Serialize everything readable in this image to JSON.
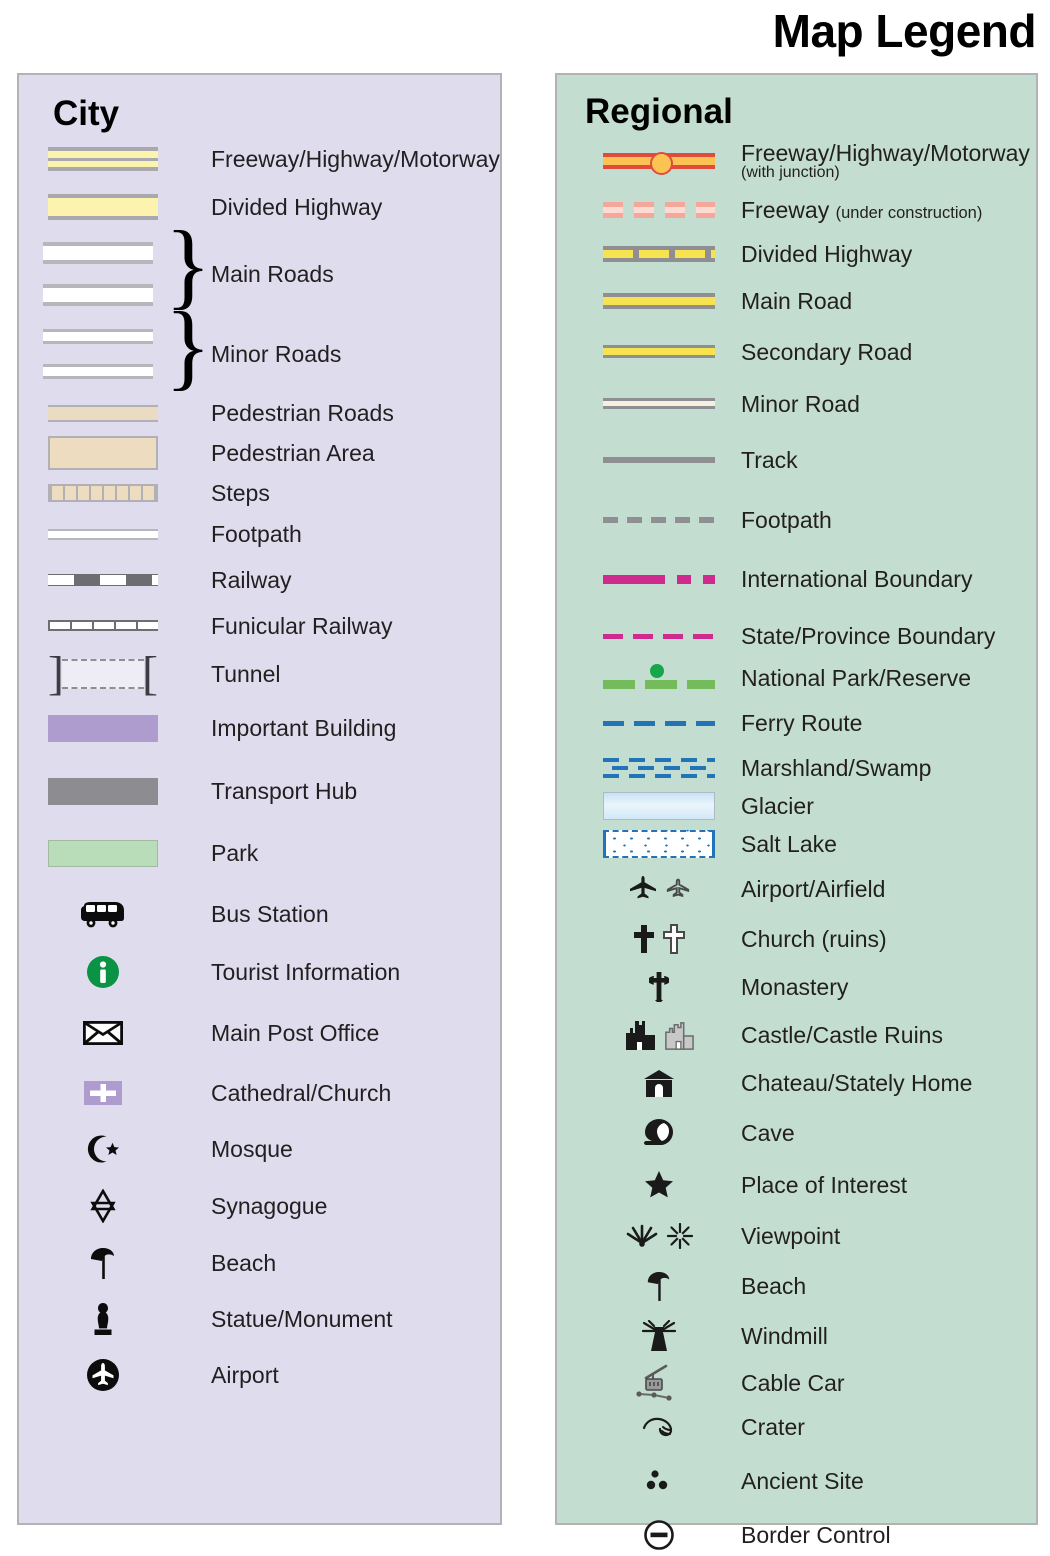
{
  "title": "Map Legend",
  "panels": {
    "city": {
      "heading": "City",
      "background_color": "#dedced",
      "items": [
        {
          "label": "Freeway/Highway/Motorway",
          "symbol": "freeway-band"
        },
        {
          "label": "Divided Highway",
          "symbol": "divided-highway-band"
        },
        {
          "label": "Main Roads",
          "symbol": "main-roads-brace-pair"
        },
        {
          "label": "Minor Roads",
          "symbol": "minor-roads-brace-pair"
        },
        {
          "label": "Pedestrian Roads",
          "symbol": "pedestrian-road-band"
        },
        {
          "label": "Pedestrian Area",
          "symbol": "pedestrian-area-swatch"
        },
        {
          "label": "Steps",
          "symbol": "steps-band"
        },
        {
          "label": "Footpath",
          "symbol": "footpath-line"
        },
        {
          "label": "Railway",
          "symbol": "railway-line"
        },
        {
          "label": "Funicular Railway",
          "symbol": "funicular-railway-line"
        },
        {
          "label": "Tunnel",
          "symbol": "tunnel-brackets"
        },
        {
          "label": "Important Building",
          "symbol": "important-building-swatch"
        },
        {
          "label": "Transport Hub",
          "symbol": "transport-hub-swatch"
        },
        {
          "label": "Park",
          "symbol": "park-swatch"
        },
        {
          "label": "Bus Station",
          "symbol": "bus-icon"
        },
        {
          "label": "Tourist Information",
          "symbol": "information-icon"
        },
        {
          "label": "Main Post Office",
          "symbol": "envelope-icon"
        },
        {
          "label": "Cathedral/Church",
          "symbol": "cross-on-purple-icon"
        },
        {
          "label": "Mosque",
          "symbol": "crescent-star-icon"
        },
        {
          "label": "Synagogue",
          "symbol": "star-of-david-icon"
        },
        {
          "label": "Beach",
          "symbol": "parasol-icon"
        },
        {
          "label": "Statue/Monument",
          "symbol": "statue-icon"
        },
        {
          "label": "Airport",
          "symbol": "airplane-circle-icon"
        }
      ]
    },
    "regional": {
      "heading": "Regional",
      "background_color": "#c3ded0",
      "items": [
        {
          "label": "Freeway/Highway/Motorway",
          "sublabel": "(with junction)",
          "sublabel_position": "below",
          "symbol": "freeway-with-junction"
        },
        {
          "label": "Freeway",
          "sublabel": "(under construction)",
          "sublabel_position": "inline",
          "symbol": "freeway-under-construction"
        },
        {
          "label": "Divided Highway",
          "symbol": "divided-highway-line"
        },
        {
          "label": "Main Road",
          "symbol": "main-road-line"
        },
        {
          "label": "Secondary Road",
          "symbol": "secondary-road-line"
        },
        {
          "label": "Minor Road",
          "symbol": "minor-road-line"
        },
        {
          "label": "Track",
          "symbol": "track-line"
        },
        {
          "label": "Footpath",
          "symbol": "footpath-dashed-line"
        },
        {
          "label": "International Boundary",
          "symbol": "international-boundary-line"
        },
        {
          "label": "State/Province Boundary",
          "symbol": "state-boundary-line"
        },
        {
          "label": "National Park/Reserve",
          "symbol": "national-park-line"
        },
        {
          "label": "Ferry Route",
          "symbol": "ferry-route-line"
        },
        {
          "label": "Marshland/Swamp",
          "symbol": "marshland-pattern"
        },
        {
          "label": "Glacier",
          "symbol": "glacier-swatch"
        },
        {
          "label": "Salt Lake",
          "symbol": "salt-lake-swatch"
        },
        {
          "label": "Airport/Airfield",
          "symbol": "airplane-pair-icon"
        },
        {
          "label": "Church (ruins)",
          "symbol": "cross-pair-icon"
        },
        {
          "label": "Monastery",
          "symbol": "monastery-cross-icon"
        },
        {
          "label": "Castle/Castle Ruins",
          "symbol": "castle-pair-icon"
        },
        {
          "label": "Chateau/Stately Home",
          "symbol": "chateau-icon"
        },
        {
          "label": "Cave",
          "symbol": "cave-icon"
        },
        {
          "label": "Place of Interest",
          "symbol": "star-icon"
        },
        {
          "label": "Viewpoint",
          "symbol": "viewpoint-pair-icon"
        },
        {
          "label": "Beach",
          "symbol": "parasol-icon"
        },
        {
          "label": "Windmill",
          "symbol": "windmill-icon"
        },
        {
          "label": "Cable Car",
          "symbol": "cable-car-icon"
        },
        {
          "label": "Crater",
          "symbol": "crater-icon"
        },
        {
          "label": "Ancient Site",
          "symbol": "ancient-site-icon"
        },
        {
          "label": "Border Control",
          "symbol": "border-control-icon"
        }
      ]
    }
  },
  "colors": {
    "city_panel": "#dedced",
    "regional_panel": "#c3ded0",
    "panel_border": "#b3b3b3",
    "road_yellow": "#fbf3ae",
    "regional_road_yellow": "#f7e34f",
    "freeway_red": "#e04b3e",
    "freeway_core": "#fbc352",
    "boundary_magenta": "#cf2b8f",
    "park_green": "#b9dcb9",
    "national_park_green": "#74bb5c",
    "water_blue": "#2273b8",
    "important_building": "#ae9cce",
    "transport_hub": "#8c8c91",
    "pedestrian_tan": "#eddcc0",
    "casing_gray": "#8e8e93",
    "text": "#231f20"
  }
}
